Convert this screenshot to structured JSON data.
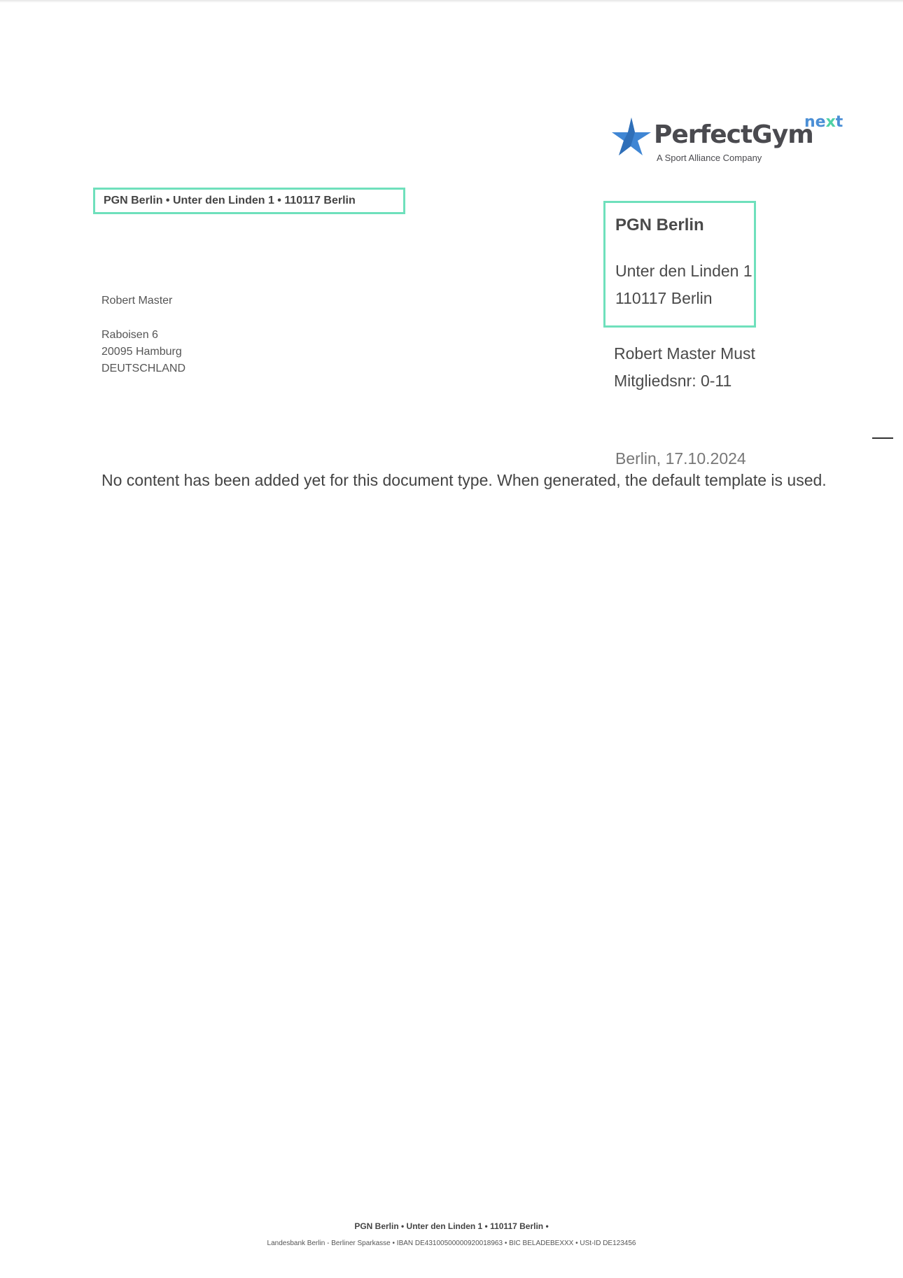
{
  "logo": {
    "wordmark": "PerfectGym",
    "badge_prefix": "ne",
    "badge_x": "x",
    "badge_suffix": "t",
    "tagline": "A Sport Alliance Company",
    "colors": {
      "star_blue": "#3f86d4",
      "badge_blue": "#4b8fd6",
      "badge_green": "#4fd1a5",
      "text": "#4a4a4f"
    }
  },
  "return_address": "PGN Berlin  •  Unter den Linden 1  •  110117 Berlin",
  "sender": {
    "name": "PGN Berlin",
    "street": "Unter den Linden 1",
    "city": "110117 Berlin"
  },
  "member": {
    "name": "Robert Master Must",
    "number": "Mitgliedsnr: 0-11"
  },
  "recipient": {
    "name": "Robert Master",
    "street": "Raboisen 6",
    "city": "20095 Hamburg",
    "country": "DEUTSCHLAND"
  },
  "date": "Berlin, 17.10.2024",
  "body": "No content has been added yet for this document type. When generated, the default template is used.",
  "footer": {
    "line1": "PGN Berlin  •  Unter den Linden 1  •  110117 Berlin  •",
    "line2": "Landesbank Berlin - Berliner Sparkasse  •  IBAN DE43100500000920018963  •  BIC BELADEBEXXX  •  USt-ID DE123456"
  },
  "accent_border_color": "#6fe0bc"
}
